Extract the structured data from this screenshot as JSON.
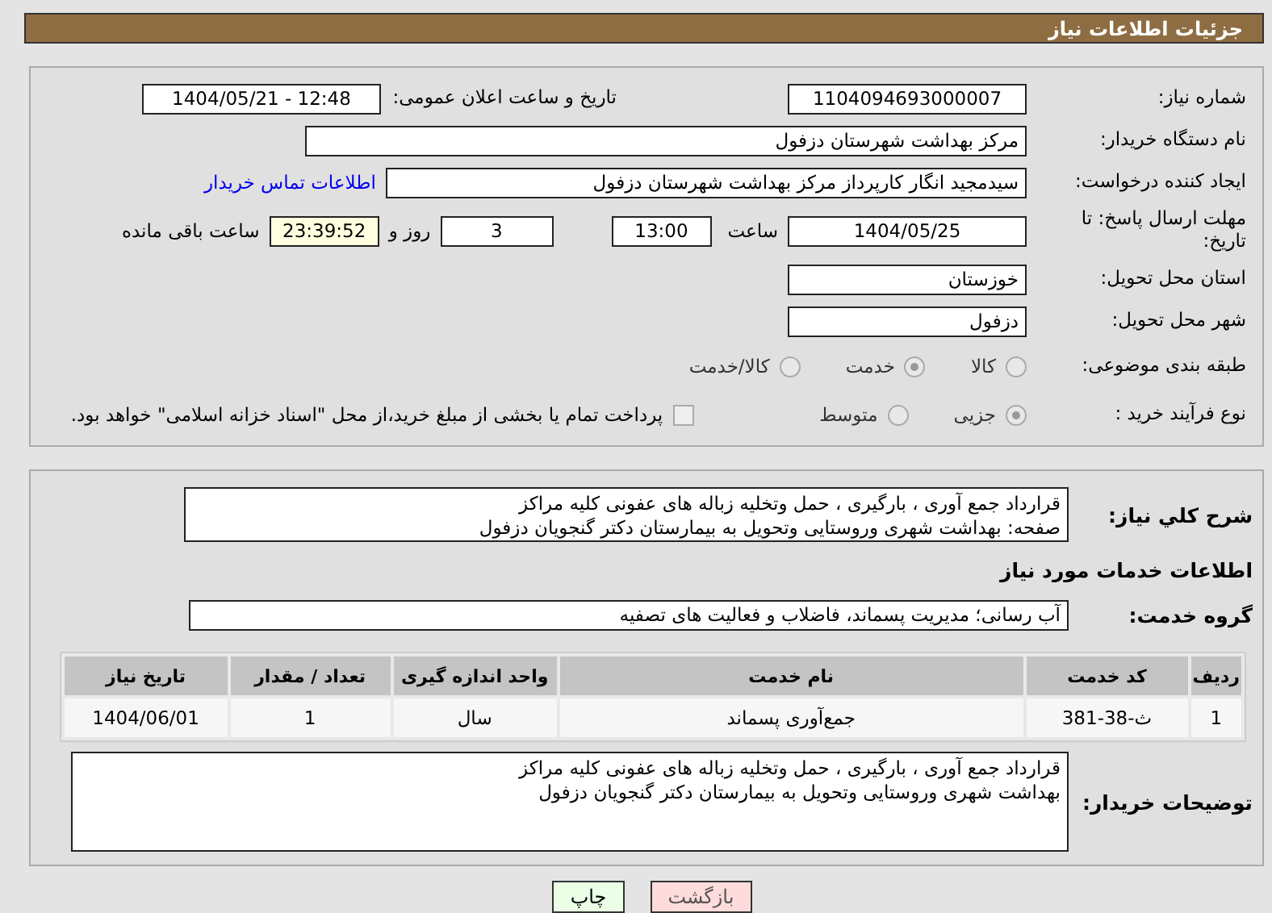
{
  "header": {
    "title": "جزئیات اطلاعات نیاز"
  },
  "need": {
    "number_label": "شماره نیاز:",
    "number": "1104094693000007",
    "announce_label": "تاریخ و ساعت اعلان عمومی:",
    "announce": "1404/05/21 - 12:48",
    "buyer_label": "نام دستگاه خریدار:",
    "buyer": "مرکز بهداشت شهرستان دزفول",
    "creator_label": "ایجاد کننده درخواست:",
    "creator": "سیدمجید انگار کارپرداز مرکز بهداشت شهرستان دزفول",
    "contact_link": "اطلاعات تماس خریدار",
    "deadline_label": "مهلت ارسال پاسخ: تا تاریخ:",
    "deadline_date": "1404/05/25",
    "time_label": "ساعت",
    "deadline_time": "13:00",
    "days": "3",
    "days_label": "روز و",
    "remaining": "23:39:52",
    "remaining_label": "ساعت باقی مانده",
    "province_label": "استان محل تحویل:",
    "province": "خوزستان",
    "city_label": "شهر محل تحویل:",
    "city": "دزفول",
    "category_label": "طبقه بندی موضوعی:",
    "category_options": [
      {
        "label": "کالا",
        "selected": false
      },
      {
        "label": "خدمت",
        "selected": true
      },
      {
        "label": "کالا/خدمت",
        "selected": false
      }
    ],
    "process_label": "نوع فرآیند خرید :",
    "process_options": [
      {
        "label": "جزیی",
        "selected": true
      },
      {
        "label": "متوسط",
        "selected": false
      }
    ],
    "treasury": {
      "label": "پرداخت تمام یا بخشی از مبلغ خرید،از محل \"اسناد خزانه اسلامی\" خواهد بود.",
      "checked": false
    }
  },
  "summary": {
    "label": "شرح كلي نياز:",
    "lines": [
      "قرارداد جمع آوری ، بارگیری ، حمل وتخلیه زباله های عفونی کلیه مراکز",
      "صفحه: بهداشت شهری وروستایی وتحویل به بیمارستان دکتر گنجویان دزفول"
    ]
  },
  "services": {
    "title": "اطلاعات خدمات مورد نیاز",
    "group_label": "گروه خدمت:",
    "group": "آب رسانی؛ مدیریت پسماند، فاضلاب و فعالیت های تصفیه",
    "table": {
      "columns": [
        "ردیف",
        "کد خدمت",
        "نام خدمت",
        "واحد اندازه گیری",
        "تعداد / مقدار",
        "تاریخ نیاز"
      ],
      "rows": [
        [
          "1",
          "ث-38-381",
          "جمع‌آوری پسماند",
          "سال",
          "1",
          "1404/06/01"
        ]
      ]
    }
  },
  "buyer_notes": {
    "label": "توضیحات خریدار:",
    "lines": [
      "قرارداد جمع آوری ، بارگیری ، حمل وتخلیه زباله های عفونی کلیه مراکز",
      "بهداشت شهری وروستایی وتحویل به بیمارستان دکتر گنجویان دزفول"
    ]
  },
  "buttons": [
    {
      "kind": "back",
      "label": "بازگشت"
    },
    {
      "kind": "print",
      "label": "چاپ"
    }
  ]
}
